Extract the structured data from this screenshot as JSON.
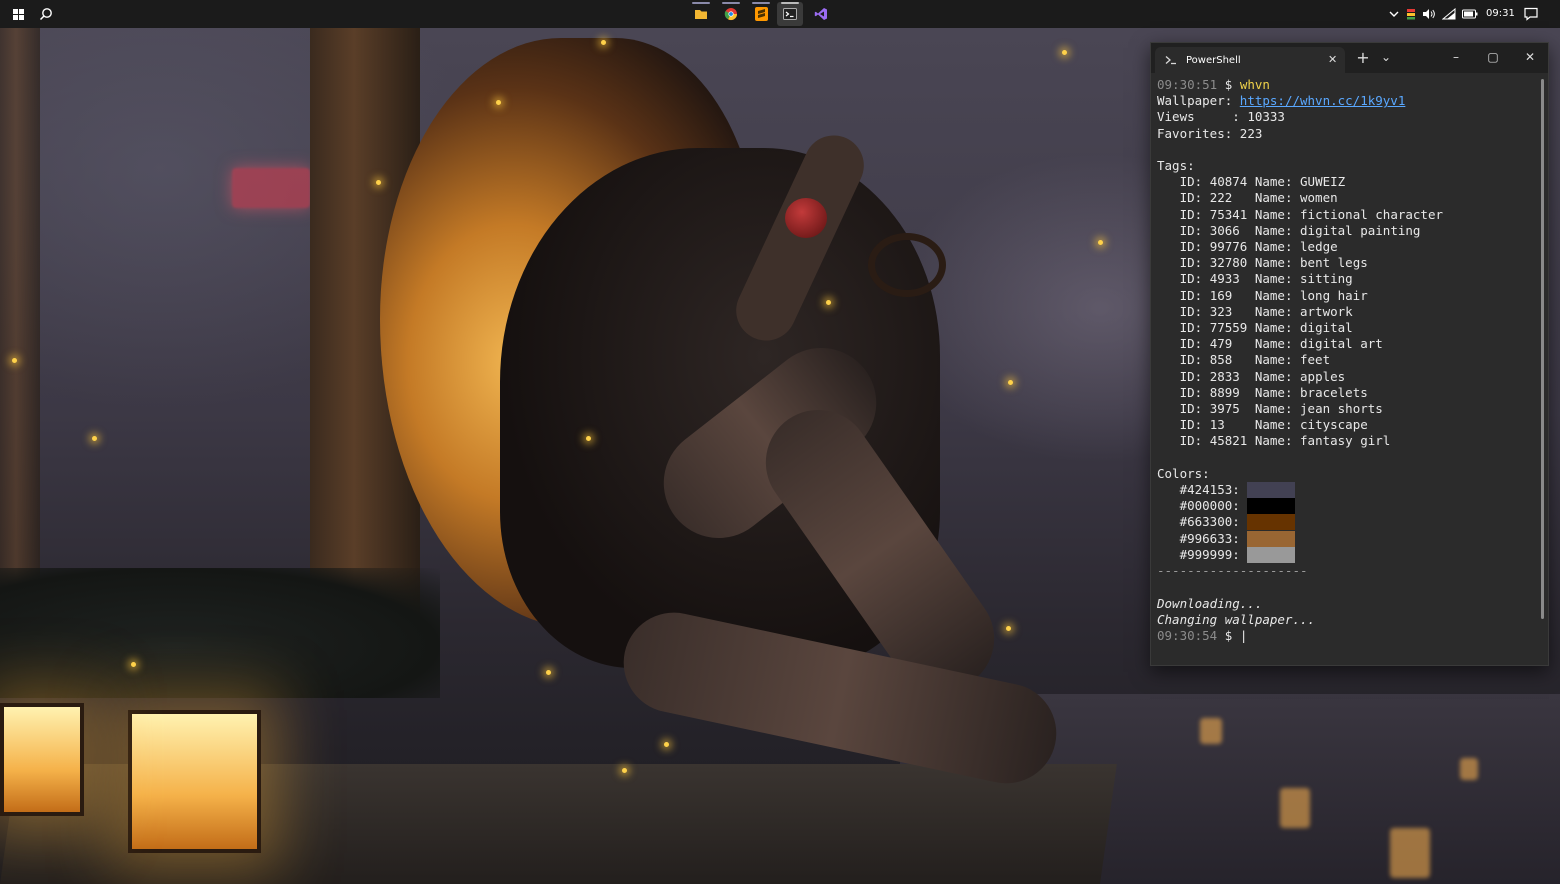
{
  "taskbar": {
    "start_icon": "windows-logo-icon",
    "search_icon": "search-icon",
    "apps": [
      {
        "name": "file-explorer",
        "icon": "folder-icon",
        "color": "#f2b632"
      },
      {
        "name": "chrome",
        "icon": "chrome-icon",
        "color": "#4caf50"
      },
      {
        "name": "sublime-text",
        "icon": "sublime-icon",
        "color": "#ff9800"
      },
      {
        "name": "terminal",
        "icon": "terminal-icon",
        "color": "#cccccc",
        "active": true
      },
      {
        "name": "visual-studio",
        "icon": "visual-studio-icon",
        "color": "#9b6cf2"
      }
    ],
    "tray": {
      "chevron_icon": "chevron-up-icon",
      "battery_indicator_icon": "bar-icon",
      "volume_icon": "volume-icon",
      "wifi_icon": "wifi-icon",
      "battery_icon": "battery-icon",
      "clock": "09:31",
      "notification_icon": "notification-icon"
    }
  },
  "terminal": {
    "tab_title": "PowerShell",
    "tab_icon": "powershell-icon",
    "new_tab_label": "+",
    "dropdown_label": "⌄",
    "minimize_label": "–",
    "maximize_label": "▢",
    "close_label": "✕",
    "tab_close_label": "✕",
    "prompt1_time": "09:30:51",
    "prompt_symbol": "$",
    "command": "whvn",
    "wallpaper_label": "Wallpaper:",
    "wallpaper_url": "https://whvn.cc/1k9yv1",
    "views_label": "Views     :",
    "views_value": "10333",
    "favorites_label": "Favorites:",
    "favorites_value": "223",
    "tags_label": "Tags:",
    "tags": [
      {
        "id": "40874",
        "name": "GUWEIZ"
      },
      {
        "id": "222",
        "name": "women"
      },
      {
        "id": "75341",
        "name": "fictional character"
      },
      {
        "id": "3066",
        "name": "digital painting"
      },
      {
        "id": "99776",
        "name": "ledge"
      },
      {
        "id": "32780",
        "name": "bent legs"
      },
      {
        "id": "4933",
        "name": "sitting"
      },
      {
        "id": "169",
        "name": "long hair"
      },
      {
        "id": "323",
        "name": "artwork"
      },
      {
        "id": "77559",
        "name": "digital"
      },
      {
        "id": "479",
        "name": "digital art"
      },
      {
        "id": "858",
        "name": "feet"
      },
      {
        "id": "2833",
        "name": "apples"
      },
      {
        "id": "8899",
        "name": "bracelets"
      },
      {
        "id": "3975",
        "name": "jean shorts"
      },
      {
        "id": "13",
        "name": "cityscape"
      },
      {
        "id": "45821",
        "name": "fantasy girl"
      }
    ],
    "colors_label": "Colors:",
    "colors": [
      "#424153",
      "#000000",
      "#663300",
      "#996633",
      "#999999"
    ],
    "separator": "--------------------",
    "status1": "Downloading...",
    "status2": "Changing wallpaper...",
    "prompt2_time": "09:30:54",
    "cursor": "|"
  }
}
